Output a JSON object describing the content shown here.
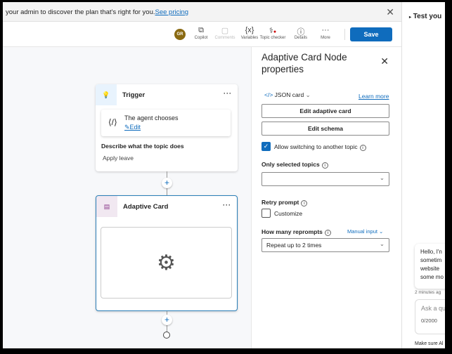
{
  "banner": {
    "text": "your admin to discover the plan that's right for you.",
    "link": "See pricing"
  },
  "toolbar": {
    "avatar": "GR",
    "items": [
      "Copilot",
      "Comments",
      "Variables",
      "Topic checker",
      "Details",
      "More"
    ],
    "save": "Save"
  },
  "trigger": {
    "title": "Trigger",
    "agent_chooses": "The agent chooses",
    "edit": "Edit",
    "describe_label": "Describe what the topic does",
    "describe_value": "Apply leave"
  },
  "adaptive_card": {
    "title": "Adaptive Card"
  },
  "props": {
    "title": "Adaptive Card Node properties",
    "json_card": "JSON card",
    "learn_more": "Learn more",
    "edit_card": "Edit adaptive card",
    "edit_schema": "Edit schema",
    "allow_switching": "Allow switching to another topic",
    "only_selected": "Only selected topics",
    "only_selected_value": "",
    "retry_prompt": "Retry prompt",
    "customize": "Customize",
    "how_many": "How many reprompts",
    "manual_input": "Manual input",
    "repeat_value": "Repeat up to 2 times"
  },
  "test": {
    "title": "Test you",
    "message": [
      "Hello, I'n",
      "sometim",
      "website",
      "some mo"
    ],
    "time": "2 minutes ag",
    "ask_placeholder": "Ask a que",
    "counter": "0/2000",
    "footer": "Make sure Al"
  }
}
